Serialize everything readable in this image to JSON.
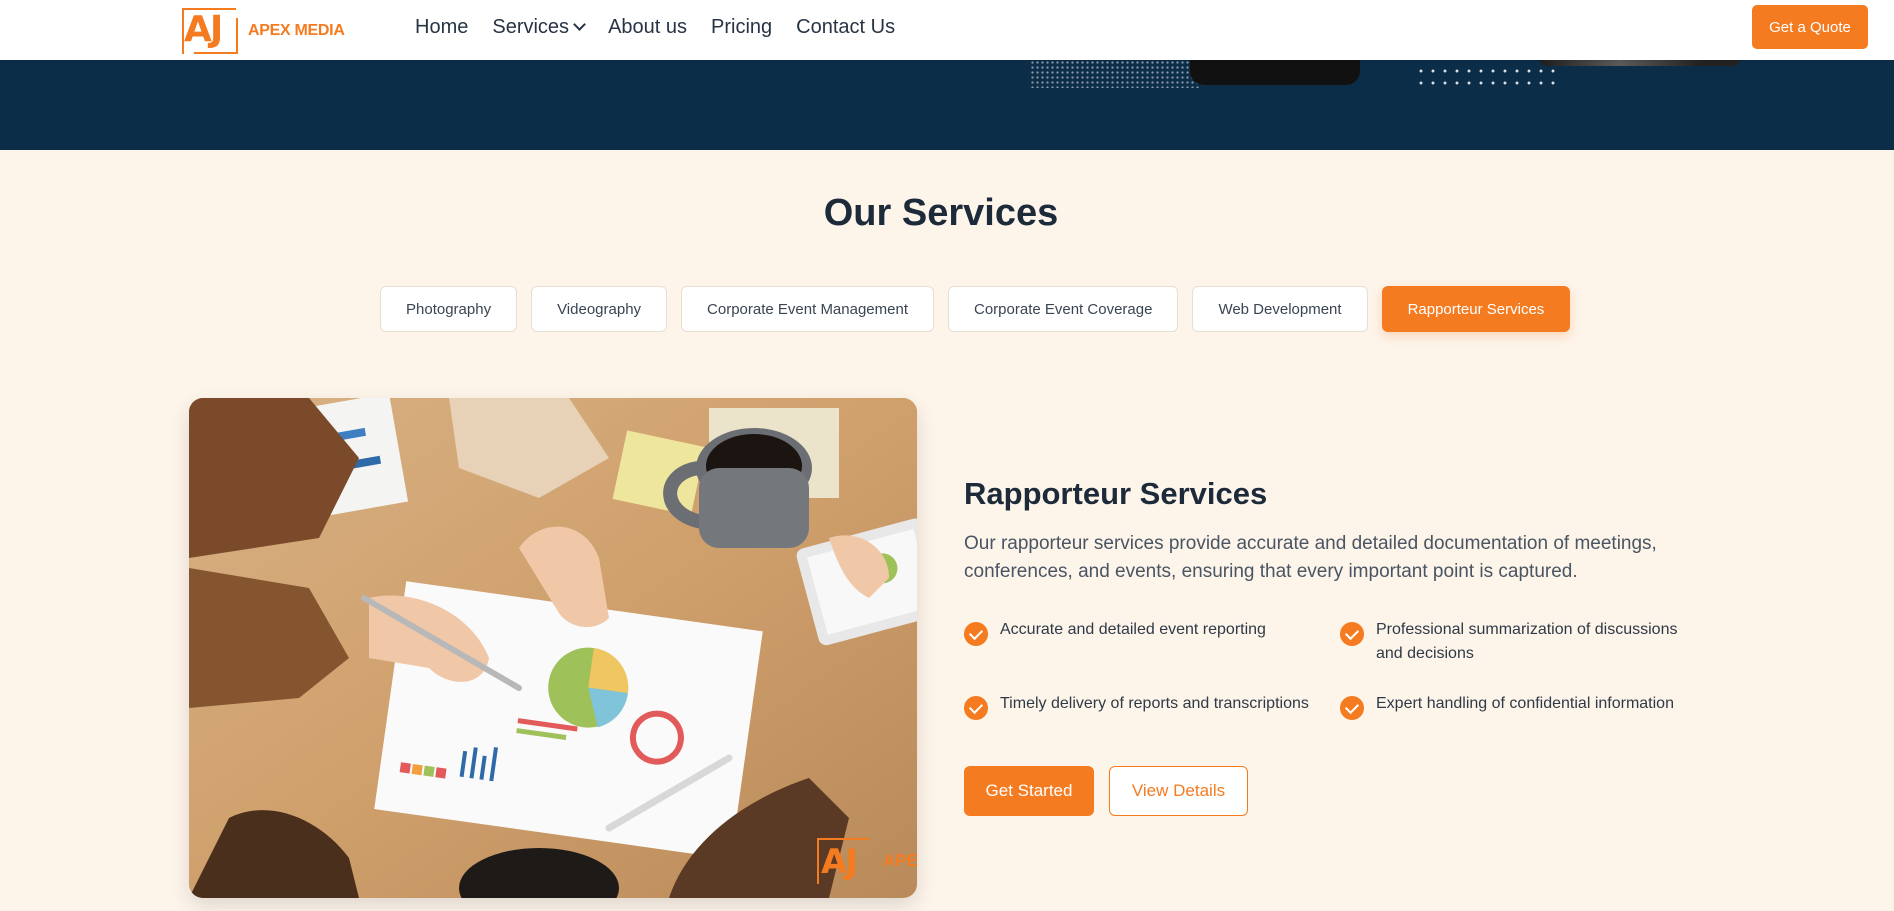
{
  "header": {
    "logo": {
      "mark": "AJ",
      "name": "APEX MEDIA"
    },
    "nav": [
      {
        "label": "Home"
      },
      {
        "label": "Services",
        "icon": "chevron-down-icon"
      },
      {
        "label": "About us"
      },
      {
        "label": "Pricing"
      },
      {
        "label": "Contact Us"
      }
    ],
    "cta_label": "Get a Quote"
  },
  "services": {
    "title": "Our Services",
    "tabs": [
      {
        "label": "Photography",
        "active": false
      },
      {
        "label": "Videography",
        "active": false
      },
      {
        "label": "Corporate Event Management",
        "active": false
      },
      {
        "label": "Corporate Event Coverage",
        "active": false
      },
      {
        "label": "Web Development",
        "active": false
      },
      {
        "label": "Rapporteur Services",
        "active": true
      }
    ],
    "detail": {
      "title": "Rapporteur Services",
      "description": "Our rapporteur services provide accurate and detailed documentation of meetings, conferences, and events, ensuring that every important point is captured.",
      "features": [
        "Accurate and detailed event reporting",
        "Professional summarization of discussions and decisions",
        "Timely delivery of reports and transcriptions",
        "Expert handling of confidential information"
      ],
      "primary_button": "Get Started",
      "secondary_button": "View Details",
      "watermark": {
        "mark": "AJ",
        "name": "APEX"
      }
    }
  },
  "colors": {
    "accent": "#f47b20",
    "navy": "#0c2d48",
    "section_bg": "#fdf4ea",
    "heading": "#1c2a3a"
  }
}
